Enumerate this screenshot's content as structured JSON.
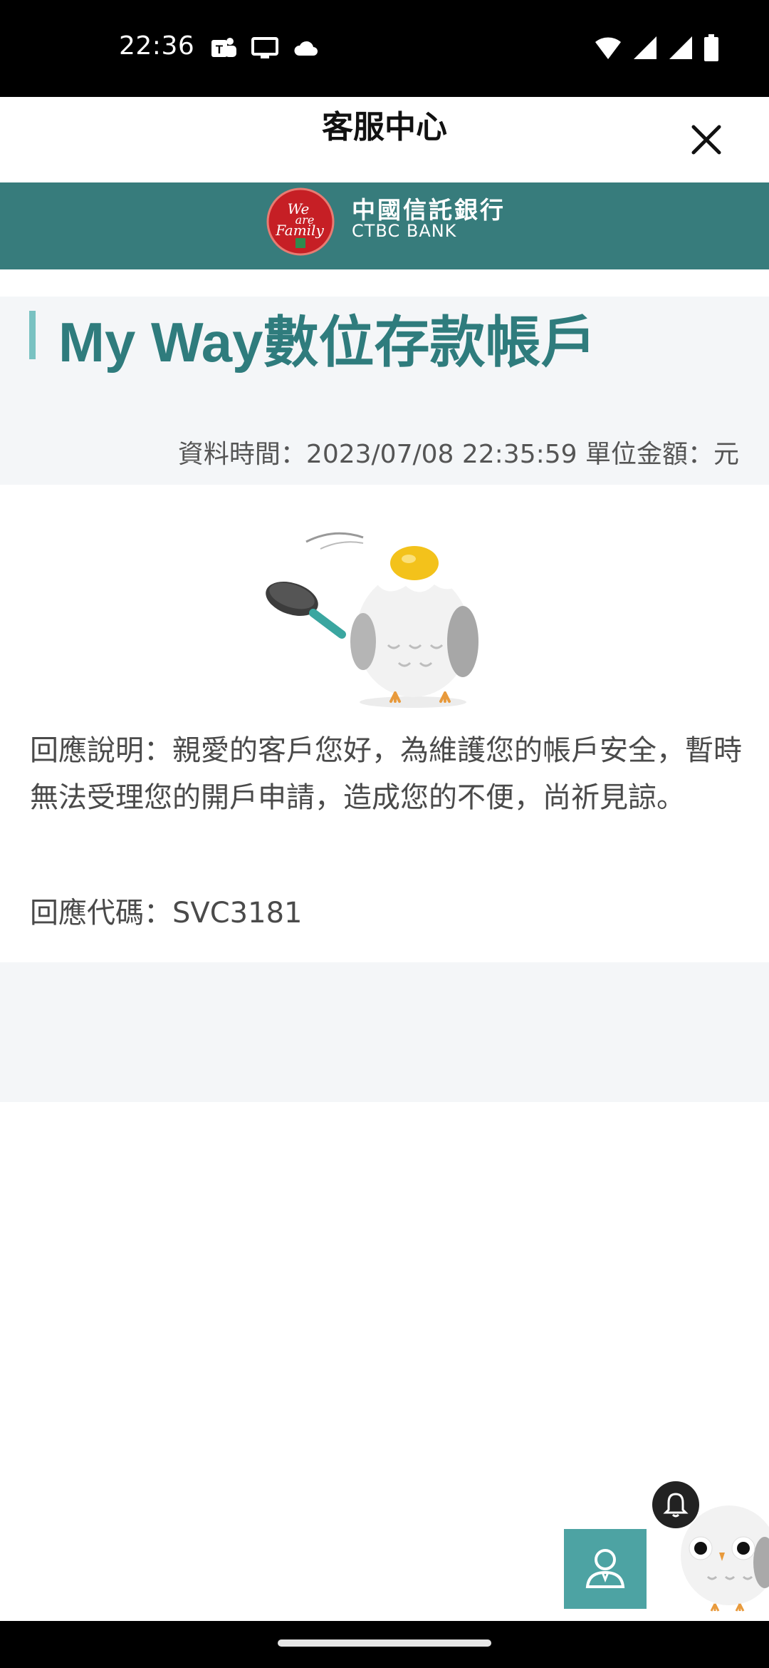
{
  "status_bar": {
    "time": "22:36",
    "left_icons": [
      "teams-icon",
      "cast-icon",
      "cloud-icon"
    ],
    "right_icons": [
      "wifi-icon",
      "signal-icon",
      "signal-icon",
      "battery-icon"
    ]
  },
  "header": {
    "title": "客服中心",
    "close_icon": "close-icon"
  },
  "brand": {
    "name_zh": "中國信託銀行",
    "name_en": "CTBC BANK",
    "logo_text": "We are Family",
    "color": "#377c7c"
  },
  "product": {
    "title": "My Way數位存款帳戶",
    "data_time": "資料時間：2023/07/08 22:35:59 單位金額：元",
    "accent_color": "#2f7c7d"
  },
  "response": {
    "message": "回應說明：親愛的客戶您好，為維護您的帳戶安全，暫時無法受理您的開戶申請，造成您的不便，尚祈見諒。",
    "code": "回應代碼：SVC3181"
  },
  "floating": {
    "service_icon": "customer-service-icon",
    "notification_icon": "bell-icon",
    "mascot": "owl-mascot"
  }
}
